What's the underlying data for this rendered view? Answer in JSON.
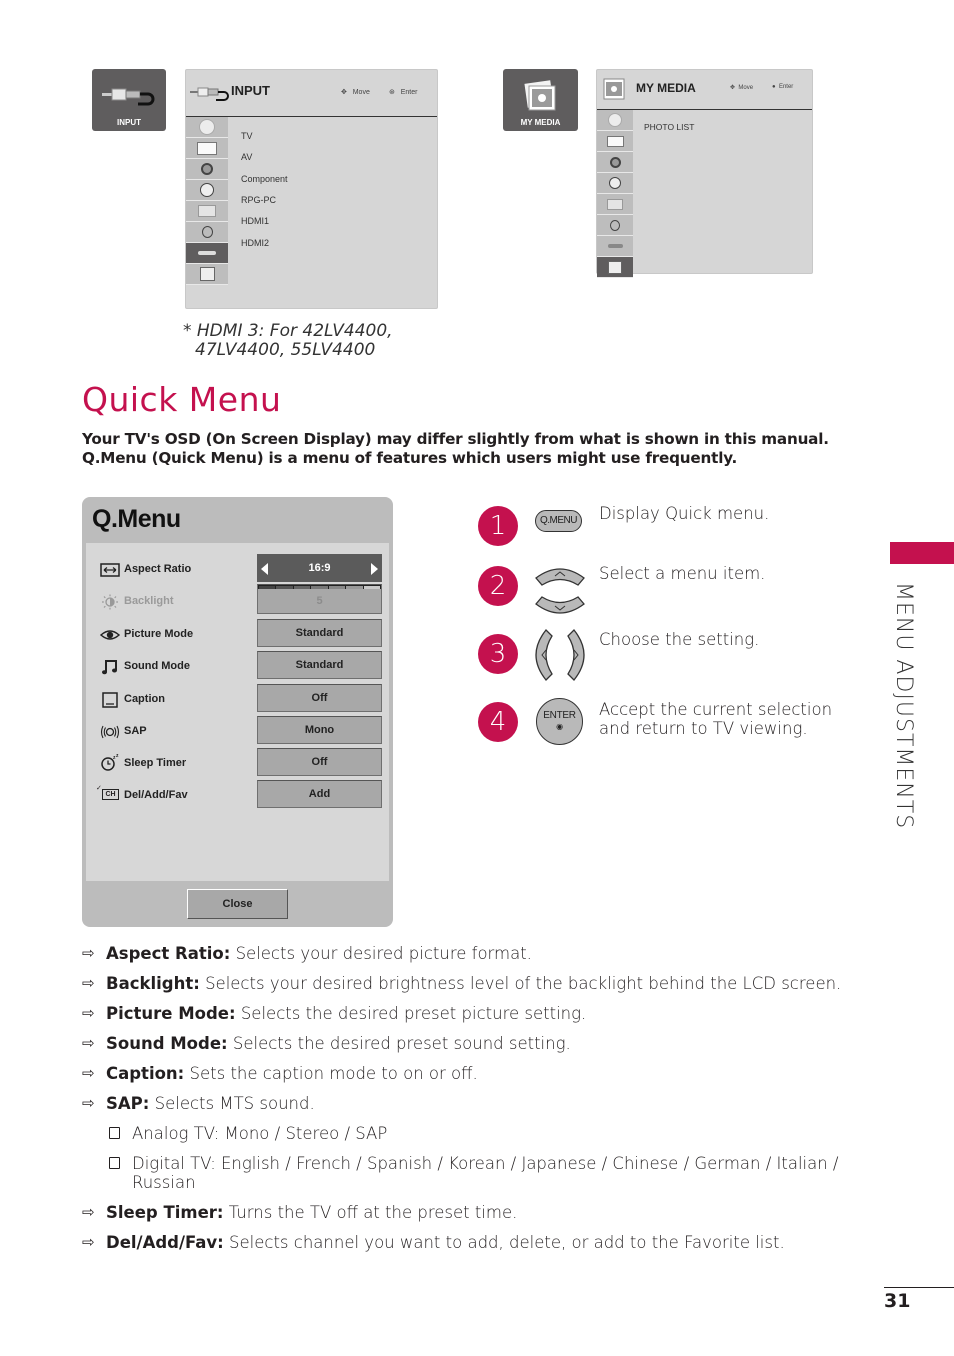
{
  "input_osd": {
    "tile_label": "INPUT",
    "title": "INPUT",
    "hint_move": "Move",
    "hint_enter": "Enter",
    "sidebar_icons": [
      "satellite-dish-icon",
      "tv-screen-icon",
      "speaker-icon",
      "clock-icon",
      "toolbox-icon",
      "lock-icon",
      "input-cable-icon",
      "my-media-icon"
    ],
    "active_sidebar_index": 6,
    "items": [
      "TV",
      "AV",
      "Component",
      "RPG-PC",
      "HDMI1",
      "HDMI2"
    ]
  },
  "my_media_osd": {
    "tile_label": "MY MEDIA",
    "title": "MY MEDIA",
    "hint_move": "Move",
    "hint_enter": "Enter",
    "sidebar_icons": [
      "satellite-dish-icon",
      "tv-screen-icon",
      "speaker-icon",
      "clock-icon",
      "toolbox-icon",
      "lock-icon",
      "input-cable-icon",
      "my-media-icon"
    ],
    "active_sidebar_index": 7,
    "items": [
      "PHOTO LIST"
    ]
  },
  "hdmi_note": {
    "line1": "* HDMI 3: For 42LV4400,",
    "line2": "47LV4400, 55LV4400"
  },
  "section": {
    "title": "Quick Menu",
    "intro": "Your TV's OSD (On Screen Display) may differ slightly from what is shown in this manual. Q.Menu (Quick Menu) is a menu of features which users might use frequently."
  },
  "qmenu": {
    "title": "Q.Menu",
    "rows": [
      {
        "label": "Aspect Ratio",
        "value": "16:9",
        "icon": "aspect-ratio-icon",
        "selected": true
      },
      {
        "label": "Backlight",
        "value": "5",
        "icon": "backlight-icon",
        "disabled": true,
        "level_fraction": 0.71
      },
      {
        "label": "Picture Mode",
        "value": "Standard",
        "icon": "eye-icon"
      },
      {
        "label": "Sound Mode",
        "value": "Standard",
        "icon": "music-note-icon"
      },
      {
        "label": "Caption",
        "value": "Off",
        "icon": "caption-icon"
      },
      {
        "label": "SAP",
        "value": "Mono",
        "icon": "sap-icon"
      },
      {
        "label": "Sleep Timer",
        "value": "Off",
        "icon": "sleep-timer-icon"
      },
      {
        "label": "Del/Add/Fav",
        "value": "Add",
        "icon": "channel-icon",
        "icon_text": "CH"
      }
    ],
    "close_label": "Close"
  },
  "steps": [
    {
      "number": "1",
      "key_label": "Q.MENU",
      "key": "qmenu-key",
      "text": "Display Quick menu."
    },
    {
      "number": "2",
      "key": "up-down-keys",
      "text": "Select a menu item."
    },
    {
      "number": "3",
      "key": "left-right-keys",
      "text": "Choose the setting."
    },
    {
      "number": "4",
      "key_label": "ENTER",
      "key": "enter-key",
      "text": "Accept the current selection and return to TV viewing."
    }
  ],
  "side_tab": {
    "label": "MENU ADJUSTMENTS",
    "accent": "#c4114e"
  },
  "descriptions": [
    {
      "term": "Aspect Ratio:",
      "text": " Selects your desired picture format."
    },
    {
      "term": "Backlight:",
      "text": " Selects your desired brightness level of the backlight behind the LCD screen."
    },
    {
      "term": "Picture Mode:",
      "text": " Selects the desired preset picture setting."
    },
    {
      "term": "Sound Mode:",
      "text": " Selects the desired preset sound setting."
    },
    {
      "term": "Caption:",
      "text": " Sets the caption mode to on or off."
    },
    {
      "term": "SAP:",
      "text": " Selects MTS sound."
    }
  ],
  "sap_options": [
    "Analog TV: Mono / Stereo / SAP",
    "Digital TV: English / French / Spanish / Korean / Japanese / Chinese / German / Italian / Russian"
  ],
  "descriptions_after": [
    {
      "term": "Sleep Timer:",
      "text": " Turns the TV off at the preset time."
    },
    {
      "term": "Del/Add/Fav:",
      "text": " Selects channel you want to add, delete, or add to the Favorite list."
    }
  ],
  "page_number": "31",
  "colors": {
    "accent": "#c4114e",
    "osd_bg": "#d6d6d6",
    "osd_dark": "#5f5d5e"
  }
}
